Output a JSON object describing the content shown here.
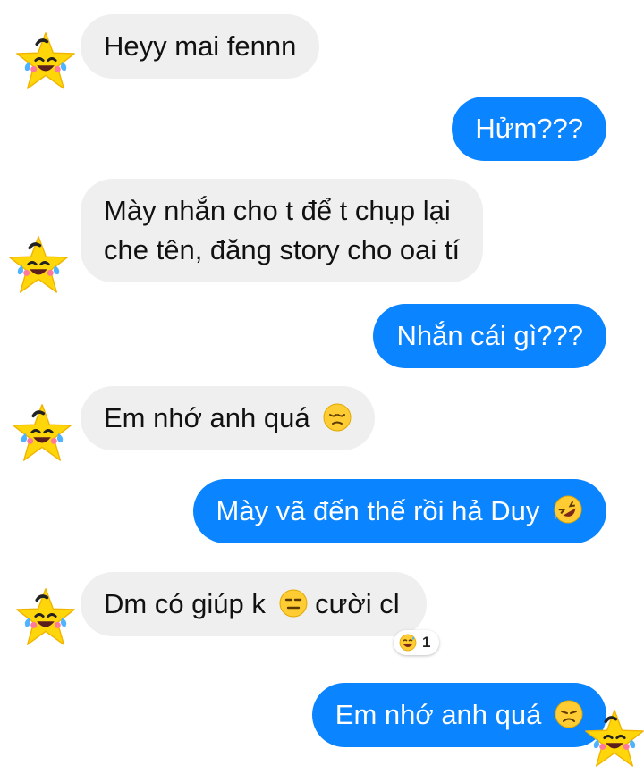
{
  "messages": [
    {
      "sender": "friend",
      "text": "Heyy mai fennn"
    },
    {
      "sender": "me",
      "text": "Hửm???"
    },
    {
      "sender": "friend",
      "text": "Mày nhắn cho t để t chụp lại",
      "text_line2": "che tên, đăng story cho oai tí"
    },
    {
      "sender": "me",
      "text": "Nhắn cái gì???"
    },
    {
      "sender": "friend",
      "text": "Em nhớ anh quá",
      "emoji": "pensive-face"
    },
    {
      "sender": "me",
      "text": "Mày vã đến thế rồi hả Duy",
      "emoji": "rofl-face"
    },
    {
      "sender": "friend",
      "text_before": "Dm có giúp k",
      "text_after": "cười cl",
      "emoji": "expressionless-face",
      "reaction": {
        "emoji": "grinning-sweat-face",
        "count": "1"
      }
    },
    {
      "sender": "me",
      "text": "Em nhớ anh quá",
      "emoji": "disappointed-face"
    }
  ],
  "avatar_icon": "crying-laughing-star-icon",
  "colors": {
    "incoming_bubble": "#efefef",
    "outgoing_bubble": "#0a84ff",
    "avatar_star": "#ffd60a"
  }
}
